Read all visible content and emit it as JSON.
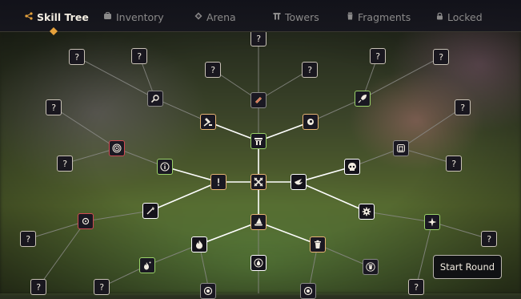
{
  "tabs": [
    {
      "id": "skill-tree",
      "label": "Skill Tree",
      "icon": "share-nodes-icon",
      "active": true
    },
    {
      "id": "inventory",
      "label": "Inventory",
      "icon": "backpack-icon",
      "active": false
    },
    {
      "id": "arena",
      "label": "Arena",
      "icon": "diamond-icon",
      "active": false
    },
    {
      "id": "towers",
      "label": "Towers",
      "icon": "tower-icon",
      "active": false
    },
    {
      "id": "fragments",
      "label": "Fragments",
      "icon": "jar-icon",
      "active": false
    },
    {
      "id": "locked",
      "label": "Locked",
      "icon": "lock-icon",
      "active": false
    }
  ],
  "unknown_symbol": "?",
  "start_round_label": "Start Round",
  "colors": {
    "active_tab": "#e6a23c",
    "unlocked_border": "#9bd36a",
    "purchasable_border": "#e7b474",
    "red_border": "#d04a52",
    "locked_border": "#c9c2b6",
    "active_link": "#ffffff",
    "inactive_link": "#8a8a86"
  },
  "skill_nodes": [
    {
      "id": "core",
      "icon": "crossed-swords-icon",
      "state": "gold"
    },
    {
      "id": "tower",
      "icon": "tower-icon",
      "state": "green"
    },
    {
      "id": "hammer",
      "icon": "hammer-icon",
      "state": "gold"
    },
    {
      "id": "rocket-badge",
      "icon": "rocket-icon",
      "state": "grey"
    },
    {
      "id": "eye",
      "icon": "eye-icon",
      "state": "gold"
    },
    {
      "id": "magnify",
      "icon": "magnifier-icon",
      "state": "grey"
    },
    {
      "id": "rocket-right",
      "icon": "rocket-icon",
      "state": "green"
    },
    {
      "id": "exclamation",
      "icon": "exclamation-icon",
      "state": "gold"
    },
    {
      "id": "info",
      "icon": "info-icon",
      "state": "green"
    },
    {
      "id": "target",
      "icon": "target-icon",
      "state": "red"
    },
    {
      "id": "bird",
      "icon": "bird-icon",
      "state": "white"
    },
    {
      "id": "skull",
      "icon": "skull-icon",
      "state": "white"
    },
    {
      "id": "shrine",
      "icon": "shrine-icon",
      "state": "grey"
    },
    {
      "id": "wand",
      "icon": "wand-icon",
      "state": "white"
    },
    {
      "id": "crosshair",
      "icon": "crosshair-icon",
      "state": "red"
    },
    {
      "id": "gear",
      "icon": "gear-icon",
      "state": "white"
    },
    {
      "id": "sparkle",
      "icon": "sparkle-icon",
      "state": "green"
    },
    {
      "id": "hat",
      "icon": "wizard-hat-icon",
      "state": "gold"
    },
    {
      "id": "fire",
      "icon": "fire-icon",
      "state": "white"
    },
    {
      "id": "trash",
      "icon": "trash-icon",
      "state": "gold"
    },
    {
      "id": "fire-small",
      "icon": "fire-icon",
      "state": "green"
    },
    {
      "id": "drop",
      "icon": "drop-icon",
      "state": "white"
    },
    {
      "id": "trash-grey",
      "icon": "trash-icon",
      "state": "grey"
    },
    {
      "id": "bottom-a",
      "icon": "coin-icon",
      "state": "grey"
    },
    {
      "id": "bottom-b",
      "icon": "coin-icon",
      "state": "grey"
    }
  ]
}
